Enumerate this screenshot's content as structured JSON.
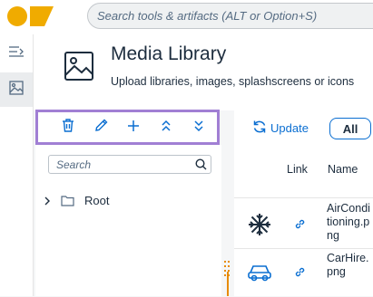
{
  "search": {
    "placeholder": "Search tools & artifacts (ALT or Option+S)"
  },
  "brand": {
    "logo_color": "#f0ab00"
  },
  "nav": [
    {
      "icon": "collapse-menu-icon"
    },
    {
      "icon": "image-icon",
      "active": true
    }
  ],
  "page": {
    "title": "Media Library",
    "subtitle": "Upload libraries, images, splashscreens or icons",
    "icon": "image-icon"
  },
  "toolbar": {
    "buttons": [
      "delete-icon",
      "edit-icon",
      "add-icon",
      "expand-all-icon",
      "collapse-all-icon"
    ],
    "highlight_color": "#a17fd4"
  },
  "tree": {
    "search_placeholder": "Search",
    "items": [
      {
        "label": "Root",
        "icon": "folder-icon"
      }
    ]
  },
  "list": {
    "update_label": "Update",
    "filter_label": "All",
    "columns": {
      "link": "Link",
      "name": "Name"
    },
    "rows": [
      {
        "icon": "snowflake-icon",
        "name": "AirConditioning.png"
      },
      {
        "icon": "car-icon",
        "name": "CarHire.png"
      }
    ]
  },
  "colors": {
    "accent": "#0a6ed1",
    "splitter": "#e78c07",
    "text": "#1d2d3e"
  }
}
